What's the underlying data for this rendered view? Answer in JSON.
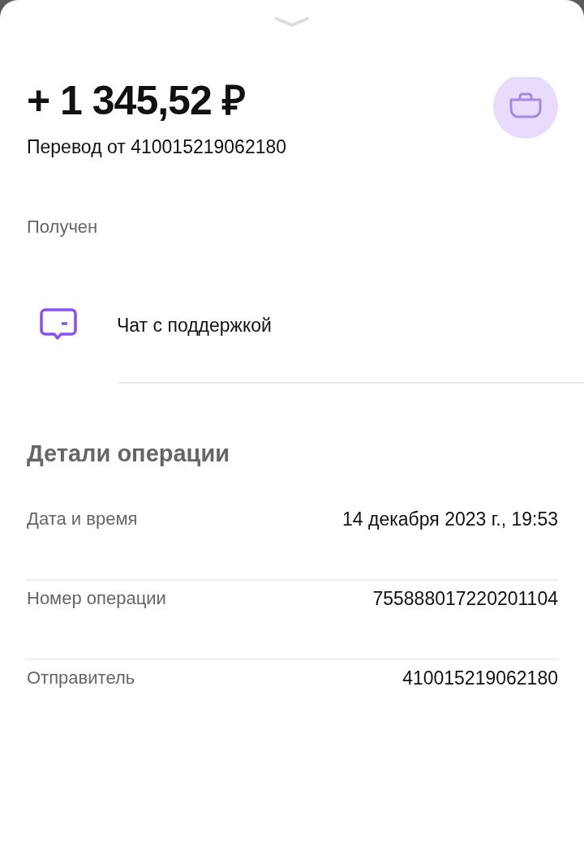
{
  "amount": "+ 1 345,52 ₽",
  "description": "Перевод от 410015219062180",
  "status": "Получен",
  "support": {
    "label": "Чат с поддержкой"
  },
  "details": {
    "title": "Детали операции",
    "rows": [
      {
        "label": "Дата и время",
        "value": "14 декабря 2023 г., 19:53"
      },
      {
        "label": "Номер операции",
        "value": "755888017220201104"
      },
      {
        "label": "Отправитель",
        "value": "410015219062180"
      }
    ]
  }
}
